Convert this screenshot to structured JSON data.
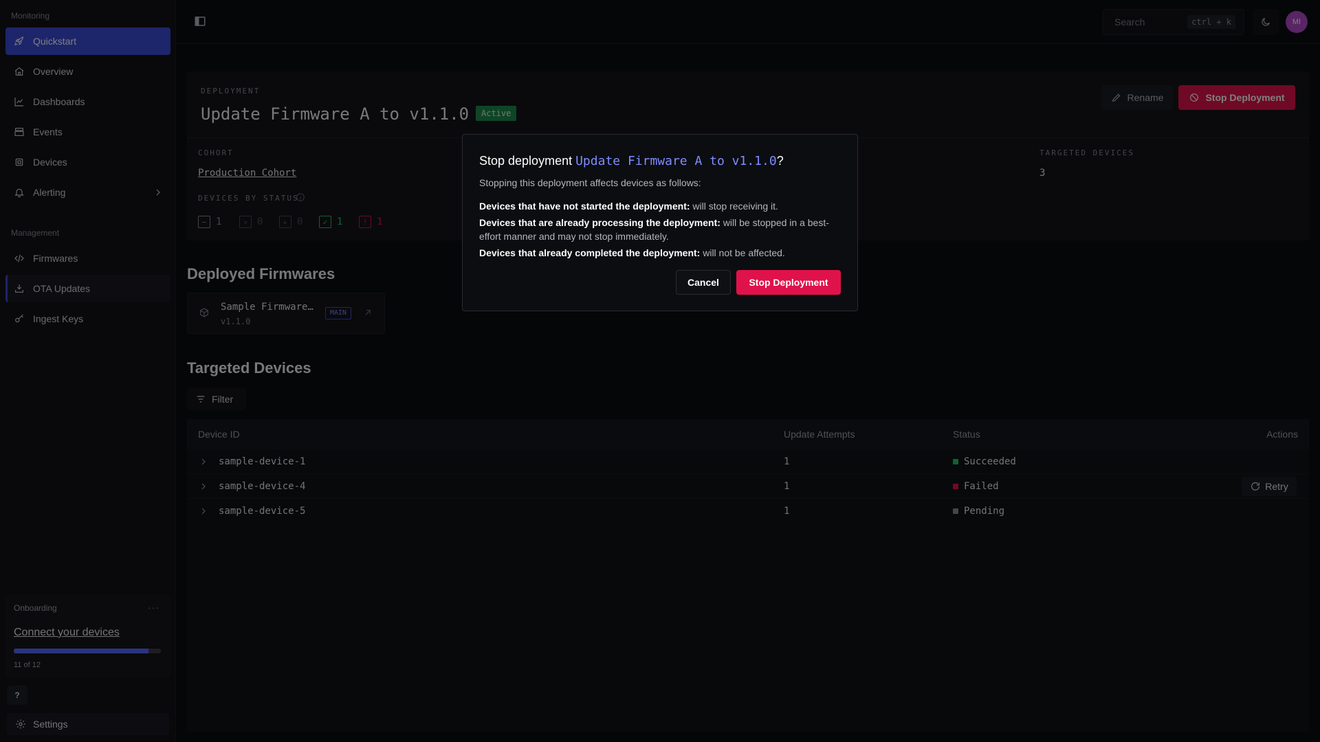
{
  "sidebar": {
    "monitoring_label": "Monitoring",
    "management_label": "Management",
    "monitoring_items": [
      {
        "label": "Quickstart",
        "icon": "rocket-icon"
      },
      {
        "label": "Overview",
        "icon": "home-icon"
      },
      {
        "label": "Dashboards",
        "icon": "chart-line-icon"
      },
      {
        "label": "Events",
        "icon": "layers-icon"
      },
      {
        "label": "Devices",
        "icon": "chip-icon"
      },
      {
        "label": "Alerting",
        "icon": "bell-icon"
      }
    ],
    "management_items": [
      {
        "label": "Firmwares",
        "icon": "code-icon"
      },
      {
        "label": "OTA Updates",
        "icon": "download-tray-icon"
      },
      {
        "label": "Ingest Keys",
        "icon": "key-icon"
      }
    ],
    "onboarding": {
      "title": "Onboarding",
      "link": "Connect your devices",
      "progress_text": "11 of 12",
      "progress_fraction": 0.917
    },
    "help_label": "?",
    "settings_label": "Settings"
  },
  "topbar": {
    "search_placeholder": "Search",
    "search_shortcut": "ctrl + k",
    "avatar_initials": "MI"
  },
  "deployment": {
    "eyebrow": "DEPLOYMENT",
    "title": "Update Firmware A to v1.1.0",
    "status_badge": "Active",
    "rename_label": "Rename",
    "stop_label": "Stop Deployment",
    "cohort_label": "COHORT",
    "cohort_value": "Production Cohort",
    "targeted_label": "TARGETED DEVICES",
    "targeted_value": "3",
    "devices_by_status_label": "DEVICES BY STATUS",
    "status_counts": [
      {
        "name": "pending",
        "count": "1",
        "color": "#8a8b93"
      },
      {
        "name": "cancelled",
        "count": "0",
        "color": "#4a4b53"
      },
      {
        "name": "in-progress",
        "count": "0",
        "color": "#4a4b53"
      },
      {
        "name": "succeeded",
        "count": "1",
        "color": "#22c55e"
      },
      {
        "name": "failed",
        "count": "1",
        "color": "#e0124b"
      }
    ]
  },
  "firmwares": {
    "heading": "Deployed Firmwares",
    "items": [
      {
        "name": "Sample Firmware…",
        "version": "v1.1.0",
        "tag": "MAIN"
      }
    ]
  },
  "devices": {
    "heading": "Targeted Devices",
    "filter_label": "Filter",
    "columns": [
      "Device ID",
      "Update Attempts",
      "Status",
      "Actions"
    ],
    "rows": [
      {
        "id": "sample-device-1",
        "attempts": "1",
        "status": "Succeeded",
        "status_color": "#22c55e",
        "action": ""
      },
      {
        "id": "sample-device-4",
        "attempts": "1",
        "status": "Failed",
        "status_color": "#e0124b",
        "action": "Retry"
      },
      {
        "id": "sample-device-5",
        "attempts": "1",
        "status": "Pending",
        "status_color": "#8a8b93",
        "action": ""
      }
    ]
  },
  "modal": {
    "title_prefix": "Stop deployment ",
    "title_accent": "Update Firmware A to v1.1.0",
    "title_suffix": "?",
    "subtitle": "Stopping this deployment affects devices as follows:",
    "lines": [
      {
        "bold": "Devices that have not started the deployment:",
        "text": " will stop receiving it."
      },
      {
        "bold": "Devices that are already processing the deployment:",
        "text": " will be stopped in a best-effort manner and may not stop immediately."
      },
      {
        "bold": "Devices that already completed the deployment:",
        "text": " will not be affected."
      }
    ],
    "cancel_label": "Cancel",
    "confirm_label": "Stop Deployment"
  }
}
